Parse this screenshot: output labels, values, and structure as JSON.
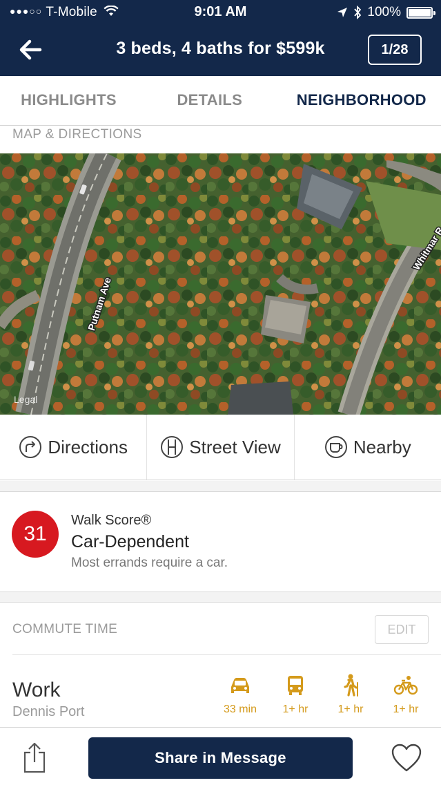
{
  "status_bar": {
    "signal": "●●●○○",
    "carrier": "T-Mobile",
    "time": "9:01 AM",
    "battery": "100%"
  },
  "nav": {
    "title": "3 beds, 4 baths for $599k",
    "pager": "1/28"
  },
  "tabs": [
    {
      "label": "HIGHLIGHTS",
      "active": false
    },
    {
      "label": "DETAILS",
      "active": false
    },
    {
      "label": "NEIGHBORHOOD",
      "active": true
    }
  ],
  "map_section": {
    "heading": "MAP & DIRECTIONS",
    "street_labels": [
      "Putnam Ave",
      "Whitmar R"
    ],
    "legal": "Legal"
  },
  "map_actions": [
    {
      "label": "Directions",
      "icon": "directions-icon"
    },
    {
      "label": "Street View",
      "icon": "street-view-icon"
    },
    {
      "label": "Nearby",
      "icon": "coffee-cup-icon"
    }
  ],
  "walk_score": {
    "score": "31",
    "label": "Walk Score®",
    "title": "Car-Dependent",
    "description": "Most errands require a car.",
    "score_color": "#d71920"
  },
  "commute": {
    "heading": "COMMUTE TIME",
    "edit_label": "EDIT",
    "destination": {
      "name": "Work",
      "town": "Dennis Port",
      "modes": [
        {
          "icon": "car-icon",
          "time": "33 min"
        },
        {
          "icon": "bus-icon",
          "time": "1+ hr"
        },
        {
          "icon": "walk-icon",
          "time": "1+ hr"
        },
        {
          "icon": "bike-icon",
          "time": "1+ hr"
        }
      ]
    },
    "accent_color": "#d49a1b"
  },
  "bottom_bar": {
    "share_button": "Share in Message"
  },
  "colors": {
    "navy": "#13284a",
    "tab_inactive": "#8b8b8b"
  }
}
